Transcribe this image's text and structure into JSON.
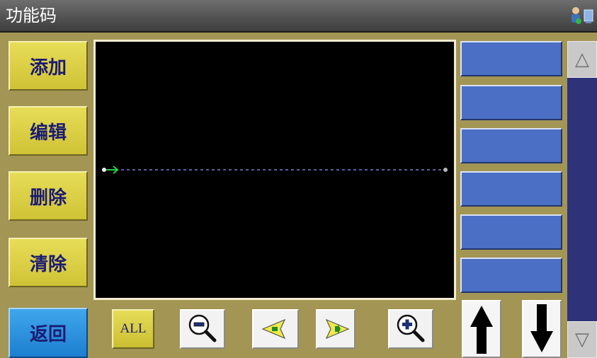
{
  "window": {
    "title": "功能码"
  },
  "status_icons": [
    "user-status-icon",
    "device-status-icon"
  ],
  "left_buttons": [
    {
      "label": "添加"
    },
    {
      "label": "编辑"
    },
    {
      "label": "删除"
    },
    {
      "label": "清除"
    }
  ],
  "back_button": {
    "label": "返回"
  },
  "toolbar": {
    "all_label": "ALL",
    "zoom_out_icon": "zoom-out-icon",
    "prev_icon": "arrow-left-icon",
    "next_icon": "arrow-right-icon",
    "zoom_in_icon": "zoom-in-icon"
  },
  "right_list": {
    "item_count": 6
  },
  "scroll": {
    "up_icon": "△",
    "down_icon": "▽"
  },
  "colors": {
    "frame": "#a39554",
    "yellow_button": "#dccf44",
    "blue_list": "#4a6fc4",
    "canvas": "#000000",
    "back_button": "#2a8fe0",
    "scroll_track": "#2e3279"
  }
}
